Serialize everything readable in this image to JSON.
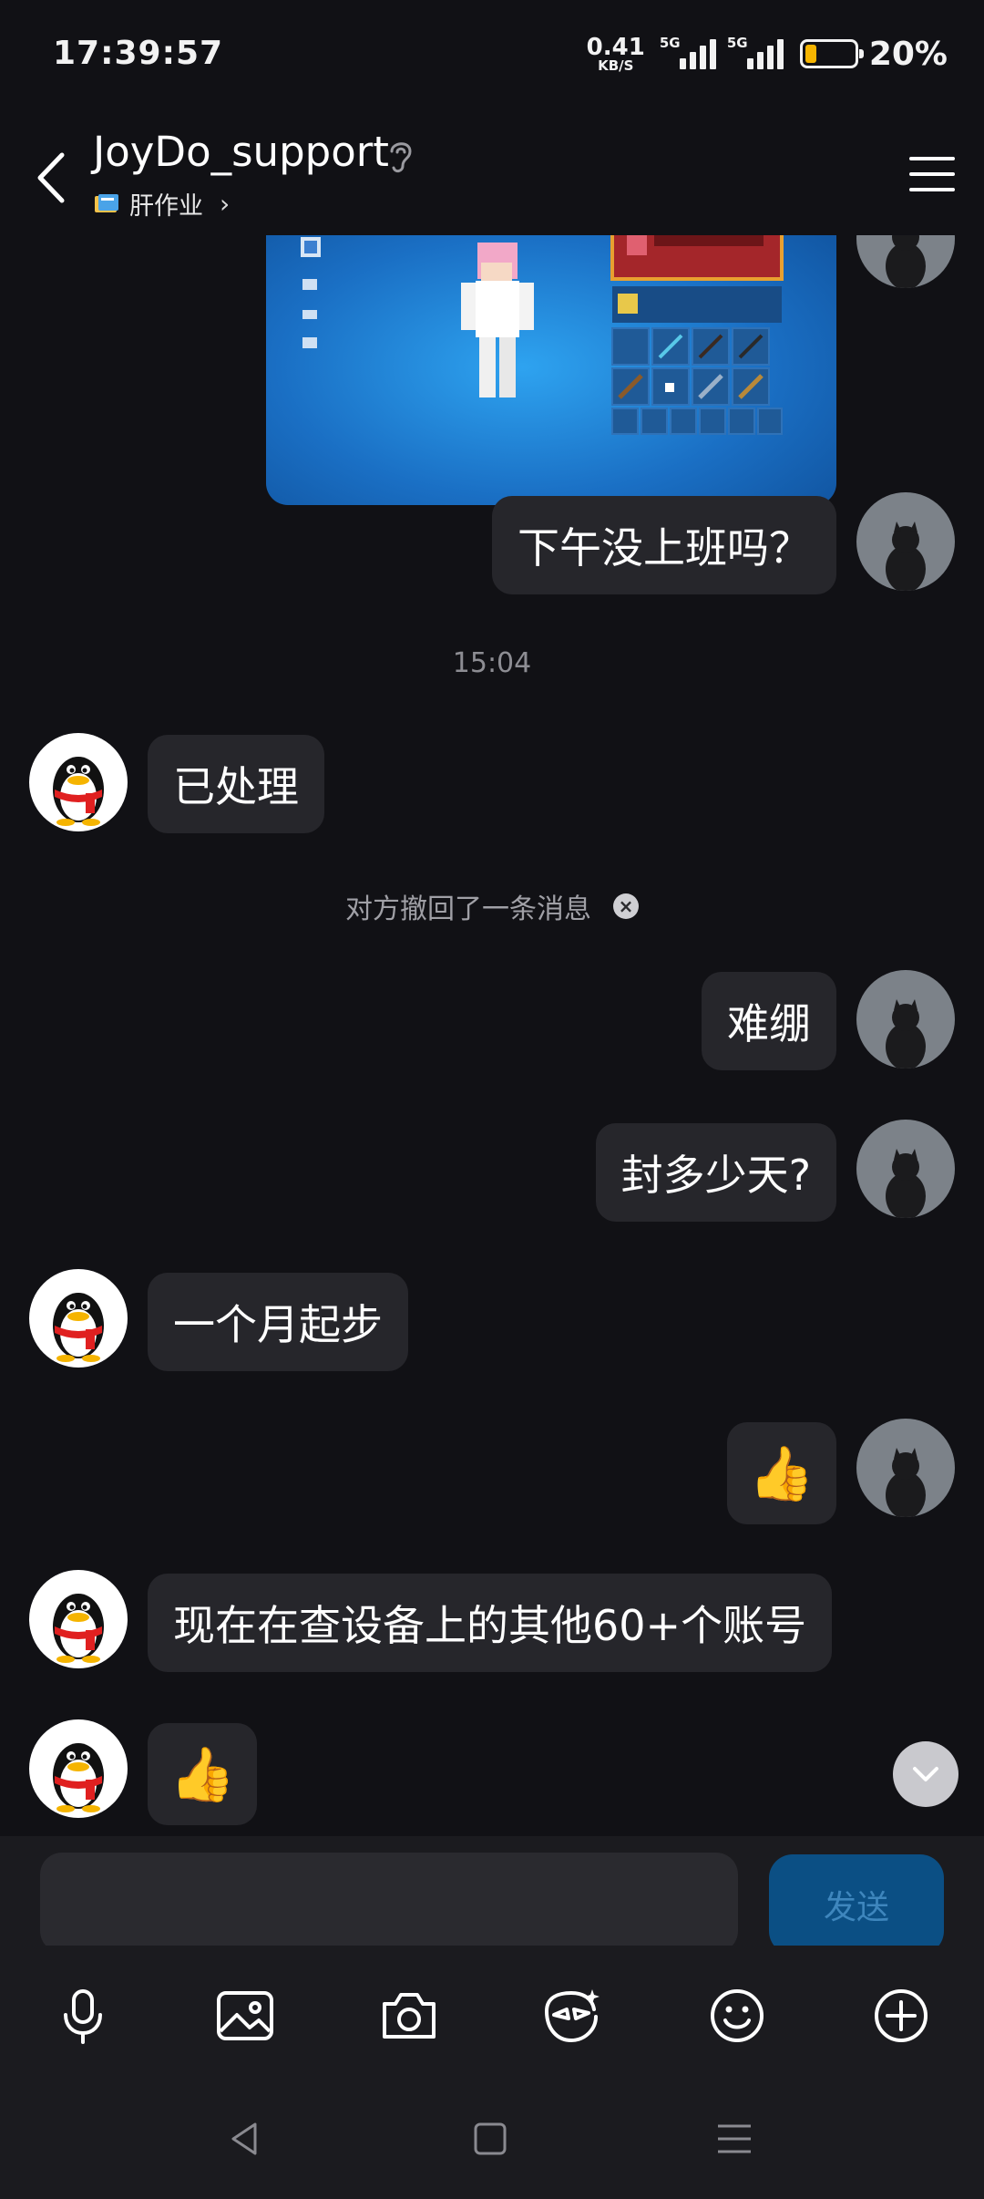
{
  "status_bar": {
    "time": "17:39:57",
    "net_speed_value": "0.41",
    "net_speed_unit": "KB/S",
    "signal_1_label": "5G",
    "signal_2_label": "5G",
    "battery_percent": "20%",
    "battery_level": 0.2,
    "battery_color": "#f5b400"
  },
  "header": {
    "title": "JoyDo_support",
    "subtitle": "肝作业",
    "icons": [
      "back-icon",
      "ear-icon",
      "book-icon",
      "chevron-right-icon",
      "menu-icon"
    ]
  },
  "messages": [
    {
      "type": "image",
      "side": "right",
      "description_icon": "game-screenshot"
    },
    {
      "type": "text",
      "side": "right",
      "text": "下午没上班吗？"
    },
    {
      "type": "time",
      "text": "15:04"
    },
    {
      "type": "text",
      "side": "left",
      "text": "已处理"
    },
    {
      "type": "recall",
      "text": "对方撤回了一条消息"
    },
    {
      "type": "text",
      "side": "right",
      "text": "难绷"
    },
    {
      "type": "text",
      "side": "right",
      "text": "封多少天?"
    },
    {
      "type": "text",
      "side": "left",
      "text": "一个月起步"
    },
    {
      "type": "emoji",
      "side": "right",
      "text": "👍"
    },
    {
      "type": "text",
      "side": "left",
      "text": "现在在查设备上的其他60+个账号"
    },
    {
      "type": "emoji",
      "side": "left",
      "text": "👍"
    }
  ],
  "input": {
    "placeholder": "",
    "send_label": "发送"
  },
  "toolbar": [
    "microphone-icon",
    "image-icon",
    "camera-icon",
    "sticker-icon",
    "emoji-icon",
    "plus-icon"
  ],
  "colors": {
    "background": "#111115",
    "bubble": "#26262b",
    "send_button": "#0b4f84",
    "send_text": "#3e86bd"
  }
}
